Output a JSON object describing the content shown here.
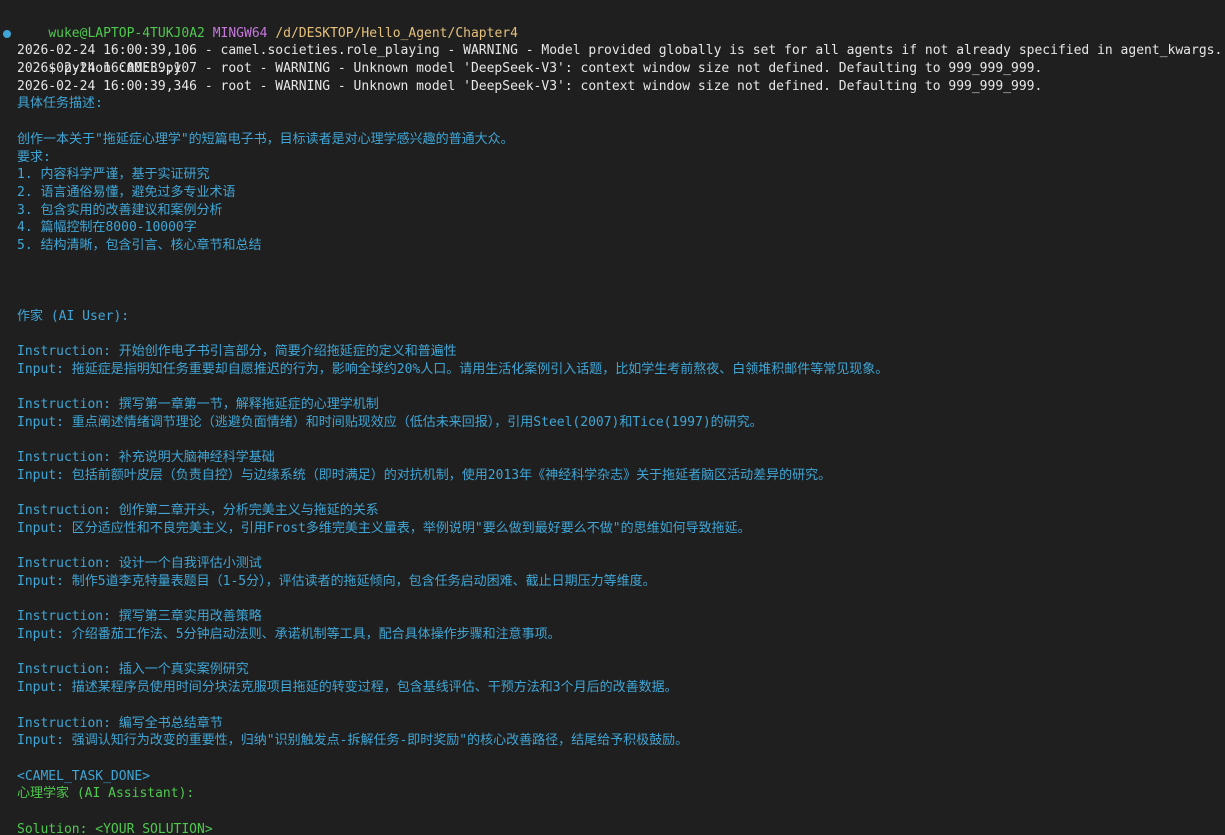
{
  "prompt": {
    "user_host": "wuke@LAPTOP-4TUKJ0A2",
    "shell": "MINGW64",
    "path": "/d/DESKTOP/Hello_Agent/Chapter4",
    "command": "$ python CAMEL.py"
  },
  "log_lines": [
    "2026-02-24 16:00:39,106 - camel.societies.role_playing - WARNING - Model provided globally is set for all agents if not already specified in agent_kwargs.",
    "2026-02-24 16:00:39,107 - root - WARNING - Unknown model 'DeepSeek-V3': context window size not defined. Defaulting to 999_999_999.",
    "2026-02-24 16:00:39,346 - root - WARNING - Unknown model 'DeepSeek-V3': context window size not defined. Defaulting to 999_999_999."
  ],
  "task": {
    "header": "具体任务描述:",
    "description": "创作一本关于\"拖延症心理学\"的短篇电子书，目标读者是对心理学感兴趣的普通大众。",
    "requirements_label": "要求:",
    "requirements": [
      "1. 内容科学严谨，基于实证研究",
      "2. 语言通俗易懂，避免过多专业术语",
      "3. 包含实用的改善建议和案例分析",
      "4. 篇幅控制在8000-10000字",
      "5. 结构清晰，包含引言、核心章节和总结"
    ]
  },
  "user_role": "作家 (AI User):",
  "exchanges": [
    {
      "instruction": "Instruction: 开始创作电子书引言部分，简要介绍拖延症的定义和普遍性",
      "input": "Input: 拖延症是指明知任务重要却自愿推迟的行为，影响全球约20%人口。请用生活化案例引入话题，比如学生考前熬夜、白领堆积邮件等常见现象。"
    },
    {
      "instruction": "Instruction: 撰写第一章第一节，解释拖延症的心理学机制",
      "input": "Input: 重点阐述情绪调节理论（逃避负面情绪）和时间贴现效应（低估未来回报），引用Steel(2007)和Tice(1997)的研究。"
    },
    {
      "instruction": "Instruction: 补充说明大脑神经科学基础",
      "input": "Input: 包括前额叶皮层（负责自控）与边缘系统（即时满足）的对抗机制，使用2013年《神经科学杂志》关于拖延者脑区活动差异的研究。"
    },
    {
      "instruction": "Instruction: 创作第二章开头，分析完美主义与拖延的关系",
      "input": "Input: 区分适应性和不良完美主义，引用Frost多维完美主义量表，举例说明\"要么做到最好要么不做\"的思维如何导致拖延。"
    },
    {
      "instruction": "Instruction: 设计一个自我评估小测试",
      "input": "Input: 制作5道李克特量表题目（1-5分），评估读者的拖延倾向，包含任务启动困难、截止日期压力等维度。"
    },
    {
      "instruction": "Instruction: 撰写第三章实用改善策略",
      "input": "Input: 介绍番茄工作法、5分钟启动法则、承诺机制等工具，配合具体操作步骤和注意事项。"
    },
    {
      "instruction": "Instruction: 插入一个真实案例研究",
      "input": "Input: 描述某程序员使用时间分块法克服项目拖延的转变过程，包含基线评估、干预方法和3个月后的改善数据。"
    },
    {
      "instruction": "Instruction: 编写全书总结章节",
      "input": "Input: 强调认知行为改变的重要性，归纳\"识别触发点-拆解任务-即时奖励\"的核心改善路径，结尾给予积极鼓励。"
    }
  ],
  "task_done": "<CAMEL_TASK_DONE>",
  "assistant_role": "心理学家 (AI Assistant):",
  "solution": "Solution: <YOUR_SOLUTION>"
}
